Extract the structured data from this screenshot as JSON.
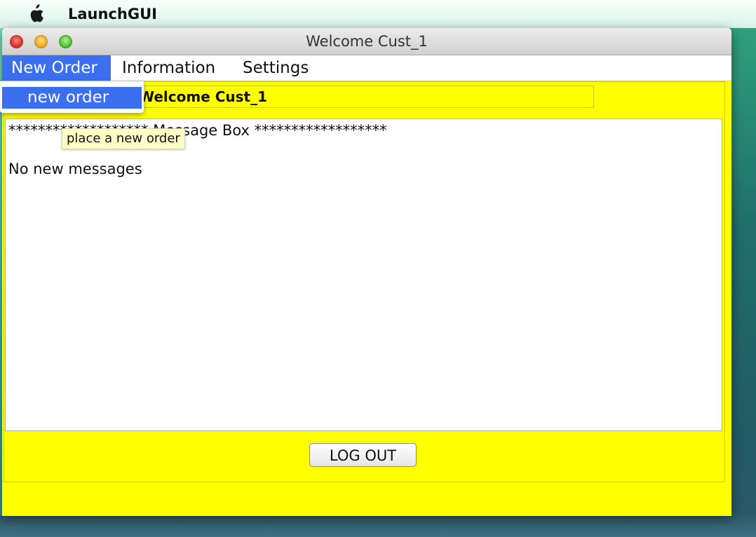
{
  "system_menubar": {
    "app_name": "LaunchGUI"
  },
  "window": {
    "title": "Welcome Cust_1"
  },
  "menubar": {
    "items": [
      {
        "label": "New Order",
        "active": true
      },
      {
        "label": "Information",
        "active": false
      },
      {
        "label": "Settings",
        "active": false
      }
    ]
  },
  "dropdown": {
    "items": [
      {
        "label": "new order",
        "highlighted": true
      }
    ]
  },
  "tooltip": {
    "text": "place a new order"
  },
  "main": {
    "welcome_text": "Welcome Cust_1",
    "message_box": {
      "header": "******************* Message Box ******************",
      "message": "No new messages"
    },
    "logout_label": "LOG OUT"
  },
  "colors": {
    "panel_background": "#ffff00",
    "menu_highlight": "#3b6ff0",
    "tooltip_background": "#ffffc6"
  }
}
